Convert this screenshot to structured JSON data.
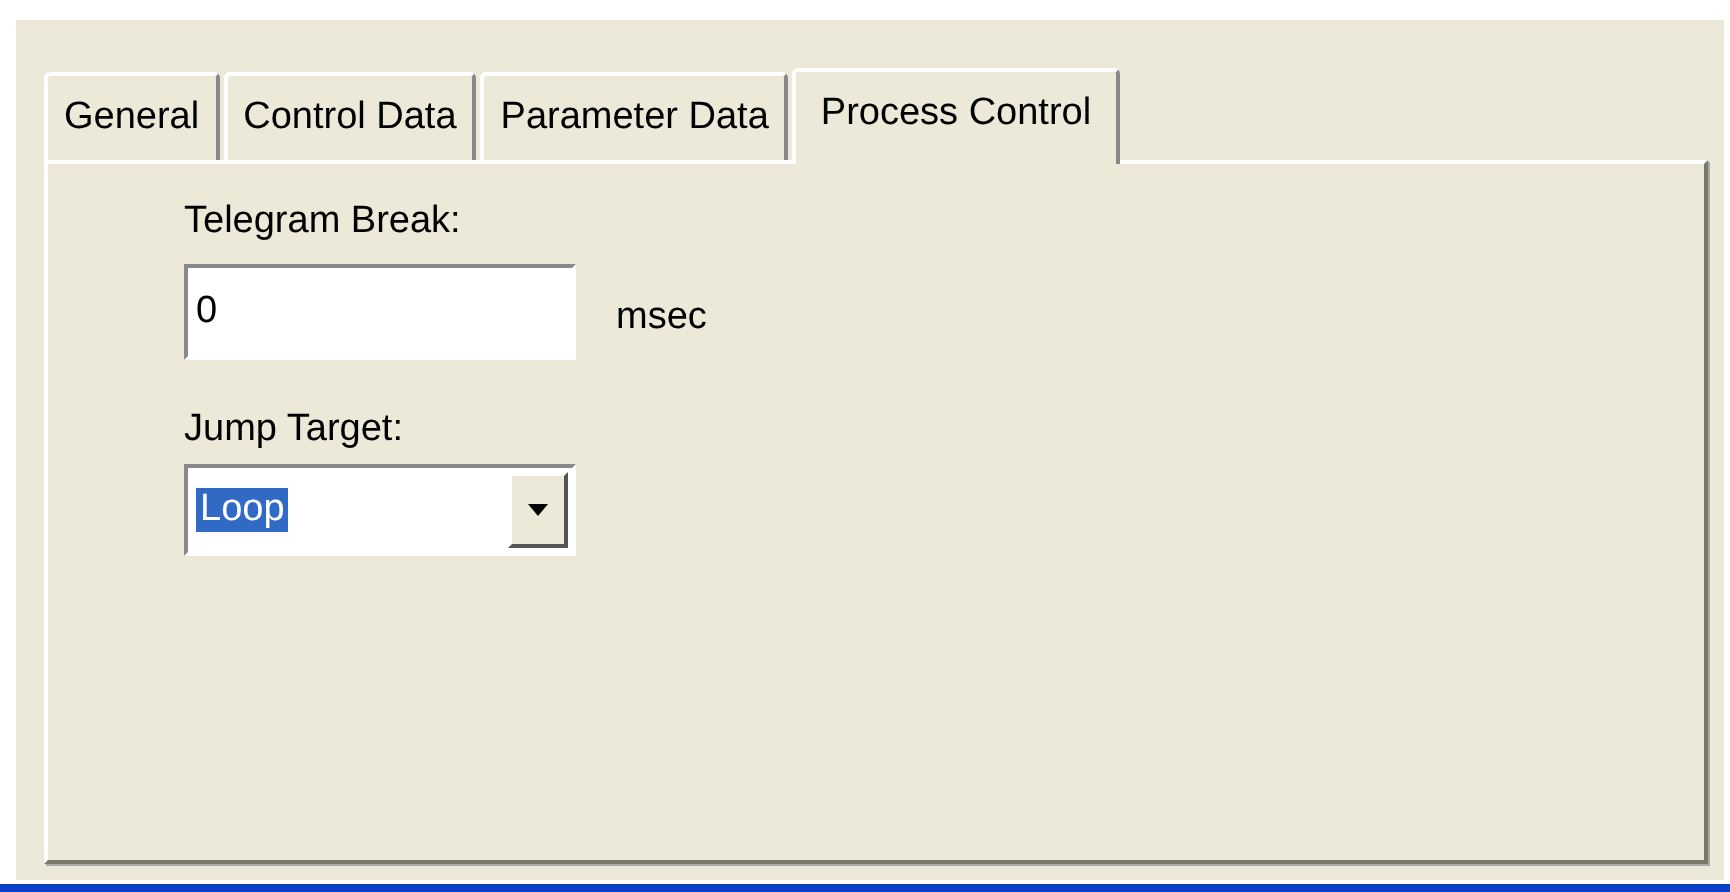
{
  "tabs": [
    {
      "label": "General",
      "selected": false
    },
    {
      "label": "Control Data",
      "selected": false
    },
    {
      "label": "Parameter Data",
      "selected": false
    },
    {
      "label": "Process Control",
      "selected": true
    }
  ],
  "telegram_break": {
    "label": "Telegram Break:",
    "value": "0",
    "unit": "msec"
  },
  "jump_target": {
    "label": "Jump Target:",
    "value": "Loop",
    "highlighted": true
  }
}
